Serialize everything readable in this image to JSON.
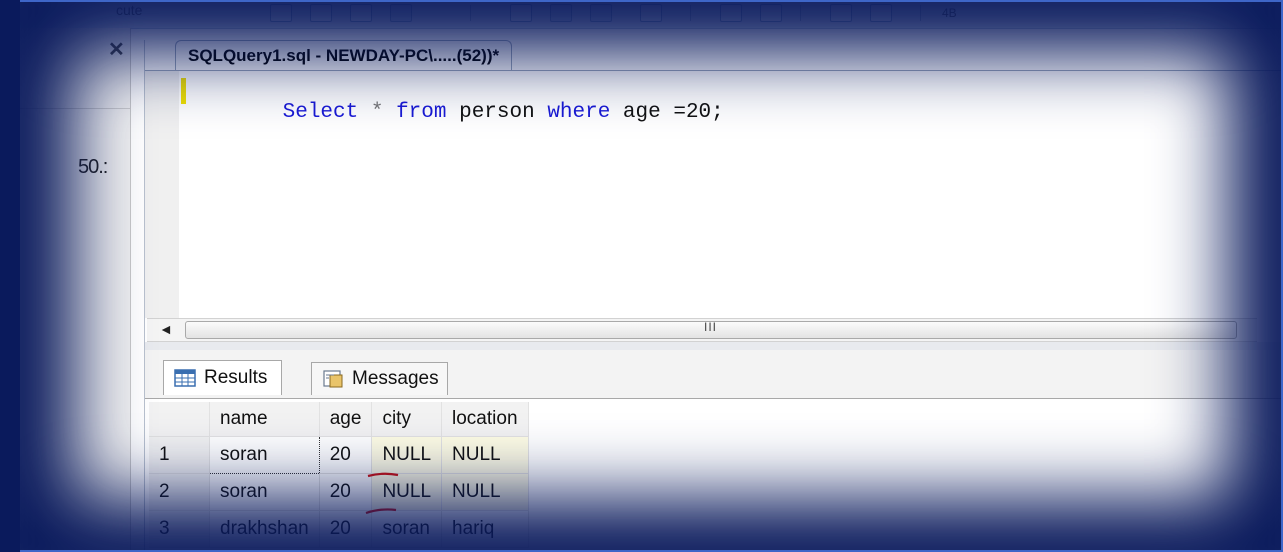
{
  "toolbar": {
    "partial_text": "cute",
    "zoom_label": "4B"
  },
  "object_explorer": {
    "close_glyph": "✕",
    "partial_server_text": "50.:"
  },
  "editor": {
    "tab_title": "SQLQuery1.sql - NEWDAY-PC\\.....(52))*",
    "code_tokens": [
      {
        "text": "Select",
        "kind": "keyword"
      },
      {
        "text": " * ",
        "kind": "operator"
      },
      {
        "text": "from",
        "kind": "keyword"
      },
      {
        "text": " person ",
        "kind": "identifier"
      },
      {
        "text": "where",
        "kind": "keyword"
      },
      {
        "text": " age =20;",
        "kind": "identifier"
      }
    ],
    "scroll_grip": "III",
    "scroll_left_arrow": "◄"
  },
  "results": {
    "tabs": [
      {
        "label": "Results",
        "icon": "grid-icon",
        "active": true
      },
      {
        "label": "Messages",
        "icon": "messages-icon",
        "active": false
      }
    ],
    "columns": [
      "name",
      "age",
      "city",
      "location"
    ],
    "rows": [
      {
        "num": "1",
        "name": "soran",
        "age": "20",
        "city": "NULL",
        "location": "NULL"
      },
      {
        "num": "2",
        "name": "soran",
        "age": "20",
        "city": "NULL",
        "location": "NULL"
      },
      {
        "num": "3",
        "name": "drakhshan",
        "age": "20",
        "city": "soran",
        "location": "hariq"
      }
    ]
  },
  "colors": {
    "keyword": "#1a1ad6",
    "vignette": "#0a1a5c",
    "null_bg": "#fffde5",
    "annotation_red": "#d01010"
  }
}
